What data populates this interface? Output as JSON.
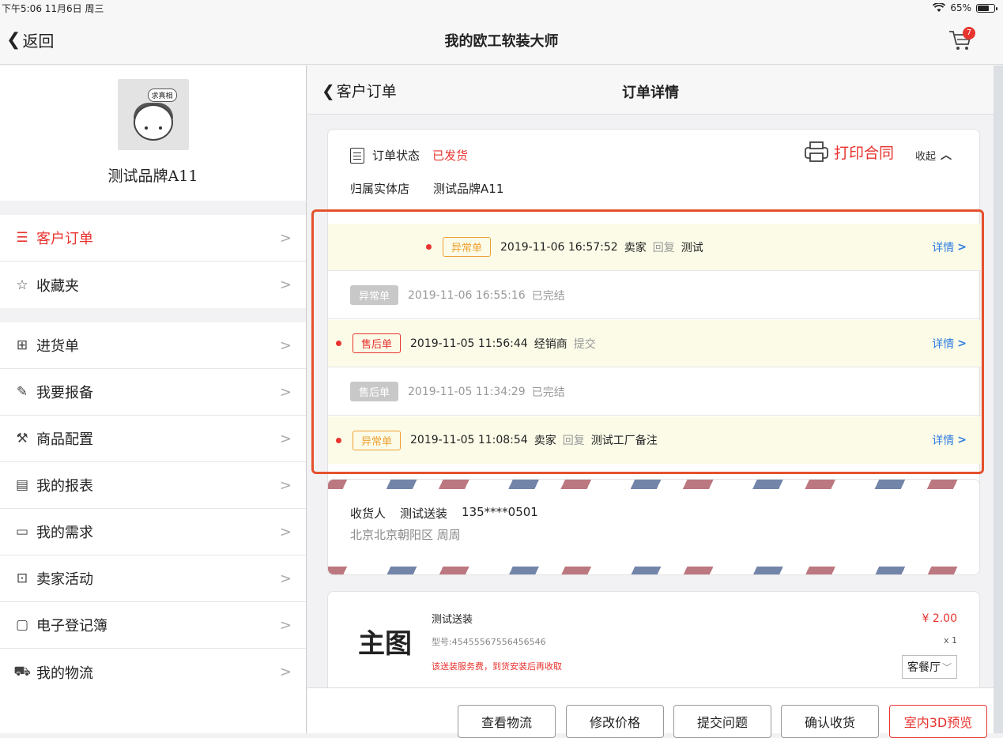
{
  "status_bar": {
    "time": "下午5:06  11月6日 周三",
    "wifi_icon": "wifi-icon",
    "battery": "65%"
  },
  "nav": {
    "back": "返回",
    "title": "我的欧工软装大师",
    "cart_badge": "7"
  },
  "sidebar": {
    "avatar_bubble": "求真相",
    "brand_name": "测试品牌A11",
    "groups": [
      [
        {
          "label": "客户订单",
          "icon": "list-icon",
          "active": true
        },
        {
          "label": "收藏夹",
          "icon": "star-icon"
        }
      ],
      [
        {
          "label": "进货单",
          "icon": "stock-icon"
        },
        {
          "label": "我要报备",
          "icon": "edit-doc-icon"
        },
        {
          "label": "商品配置",
          "icon": "wrench-icon"
        },
        {
          "label": "我的报表",
          "icon": "report-icon"
        },
        {
          "label": "我的需求",
          "icon": "chat-icon"
        },
        {
          "label": "卖家活动",
          "icon": "activity-icon"
        },
        {
          "label": "电子登记簿",
          "icon": "wallet-icon"
        },
        {
          "label": "我的物流",
          "icon": "truck-icon"
        }
      ]
    ]
  },
  "sub_nav": {
    "back": "客户订单",
    "title": "订单详情"
  },
  "order": {
    "status_label": "订单状态",
    "status_value": "已发货",
    "store_label": "归属实体店",
    "store_value": "测试品牌A11",
    "print_label": "打印合同",
    "collapse_label": "收起"
  },
  "events": [
    {
      "tag": "异常单",
      "tag_style": "orange",
      "dot": true,
      "indent": true,
      "time": "2019-11-06 16:57:52",
      "actor": "卖家",
      "action": "回复",
      "note": "测试",
      "detail": "详情",
      "highlight": true
    },
    {
      "tag": "异常单",
      "tag_style": "gray",
      "dot": false,
      "indent": false,
      "time": "2019-11-06 16:55:16",
      "actor": "",
      "action": "",
      "note": "已完结",
      "detail": "",
      "highlight": false
    },
    {
      "tag": "售后单",
      "tag_style": "red",
      "dot": true,
      "indent": false,
      "time": "2019-11-05 11:56:44",
      "actor": "经销商",
      "action": "提交",
      "note": "",
      "detail": "详情",
      "highlight": true
    },
    {
      "tag": "售后单",
      "tag_style": "gray",
      "dot": false,
      "indent": false,
      "time": "2019-11-05 11:34:29",
      "actor": "",
      "action": "",
      "note": "已完结",
      "detail": "",
      "highlight": false
    },
    {
      "tag": "异常单",
      "tag_style": "orange",
      "dot": true,
      "indent": false,
      "time": "2019-11-05 11:08:54",
      "actor": "卖家",
      "action": "回复",
      "note": "测试工厂备注",
      "detail": "详情",
      "highlight": true
    }
  ],
  "address": {
    "receiver_label": "收货人",
    "receiver_name": "测试送装",
    "phone": "135****0501",
    "address": "北京北京朝阳区 周周"
  },
  "product": {
    "image_text": "主图",
    "name": "测试送装",
    "model": "型号:45455567556456546",
    "note": "该送装服务费，到货安装后再收取",
    "price": "¥ 2.00",
    "qty": "x 1",
    "room": "客餐厅"
  },
  "actions": [
    "查看物流",
    "修改价格",
    "提交问题",
    "确认收货",
    "室内3D预览"
  ],
  "colors": {
    "accent": "#e8332f",
    "link": "#2f7de1",
    "highlight_bg": "#fbfbe8",
    "box_border": "#e5512d"
  }
}
